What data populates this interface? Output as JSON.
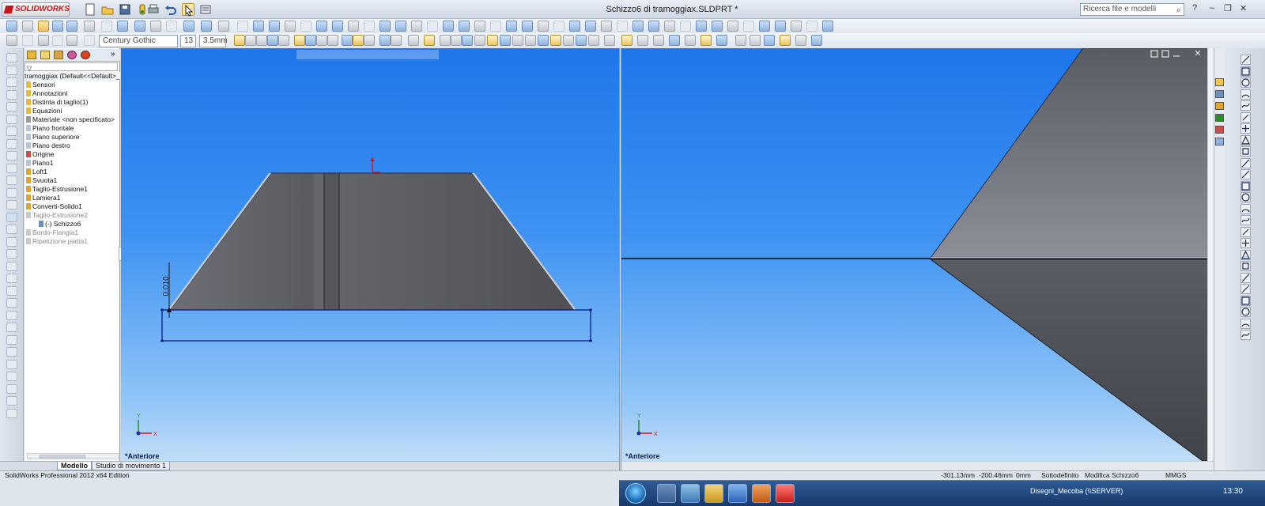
{
  "app": {
    "name": "SOLIDWORKS",
    "document_title": "Schizzo6 di tramoggiax.SLDPRT *"
  },
  "search": {
    "placeholder": "Ricerca file e modelli"
  },
  "window_controls": {
    "help": "?",
    "minimize": "–",
    "restore": "❐",
    "close": "✕"
  },
  "toolbar": {
    "font_name": "Century Gothic",
    "font_size": "13",
    "line_height": "3.5mm"
  },
  "feature_tree": {
    "root": "tramoggiax  (Default<<Default>_Stato",
    "items": [
      {
        "label": "Sensori",
        "state": "normal"
      },
      {
        "label": "Annotazioni",
        "state": "normal"
      },
      {
        "label": "Distinta di taglio(1)",
        "state": "normal"
      },
      {
        "label": "Equazioni",
        "state": "normal"
      },
      {
        "label": "Materiale <non specificato>",
        "state": "normal"
      },
      {
        "label": "Piano frontale",
        "state": "normal"
      },
      {
        "label": "Piano superiore",
        "state": "normal"
      },
      {
        "label": "Piano destro",
        "state": "normal"
      },
      {
        "label": "Origine",
        "state": "normal"
      },
      {
        "label": "Piano1",
        "state": "normal"
      },
      {
        "label": "Loft1",
        "state": "normal"
      },
      {
        "label": "Svuota1",
        "state": "normal"
      },
      {
        "label": "Taglio-Estrusione1",
        "state": "normal"
      },
      {
        "label": "Lamiera1",
        "state": "normal"
      },
      {
        "label": "Converti-Solido1",
        "state": "normal"
      },
      {
        "label": "Taglio-Estrusione2",
        "state": "dim"
      },
      {
        "label": "(-) Schizzo6",
        "state": "sub"
      },
      {
        "label": "Bordo-Flangia1",
        "state": "dim"
      },
      {
        "label": "Ripetizione piatta1",
        "state": "dim"
      }
    ]
  },
  "viewports": {
    "left": {
      "label": "*Anteriore",
      "dimension": "0,010"
    },
    "right": {
      "label": "*Anteriore"
    }
  },
  "bottom_tabs": [
    {
      "label": "Modello",
      "active": true
    },
    {
      "label": "Studio di movimento 1",
      "active": false
    }
  ],
  "status_bar": {
    "edition": "SolidWorks Professional 2012 x64 Edition",
    "x": "-301.13mm",
    "y": "-200.46mm",
    "z": "0mm",
    "definition": "Sottodefinito",
    "mode": "Modifica Schizzo6",
    "units": "MMGS"
  },
  "taskbar": {
    "network_label": "Disegni_Mecoba (\\\\SERVER)",
    "clock": "13:30"
  },
  "colors": {
    "viewport_top": "#1f76ea",
    "viewport_bottom": "#c2ddf8",
    "model_face": "#5b5c62",
    "sketch_line": "#0a1a8a"
  }
}
